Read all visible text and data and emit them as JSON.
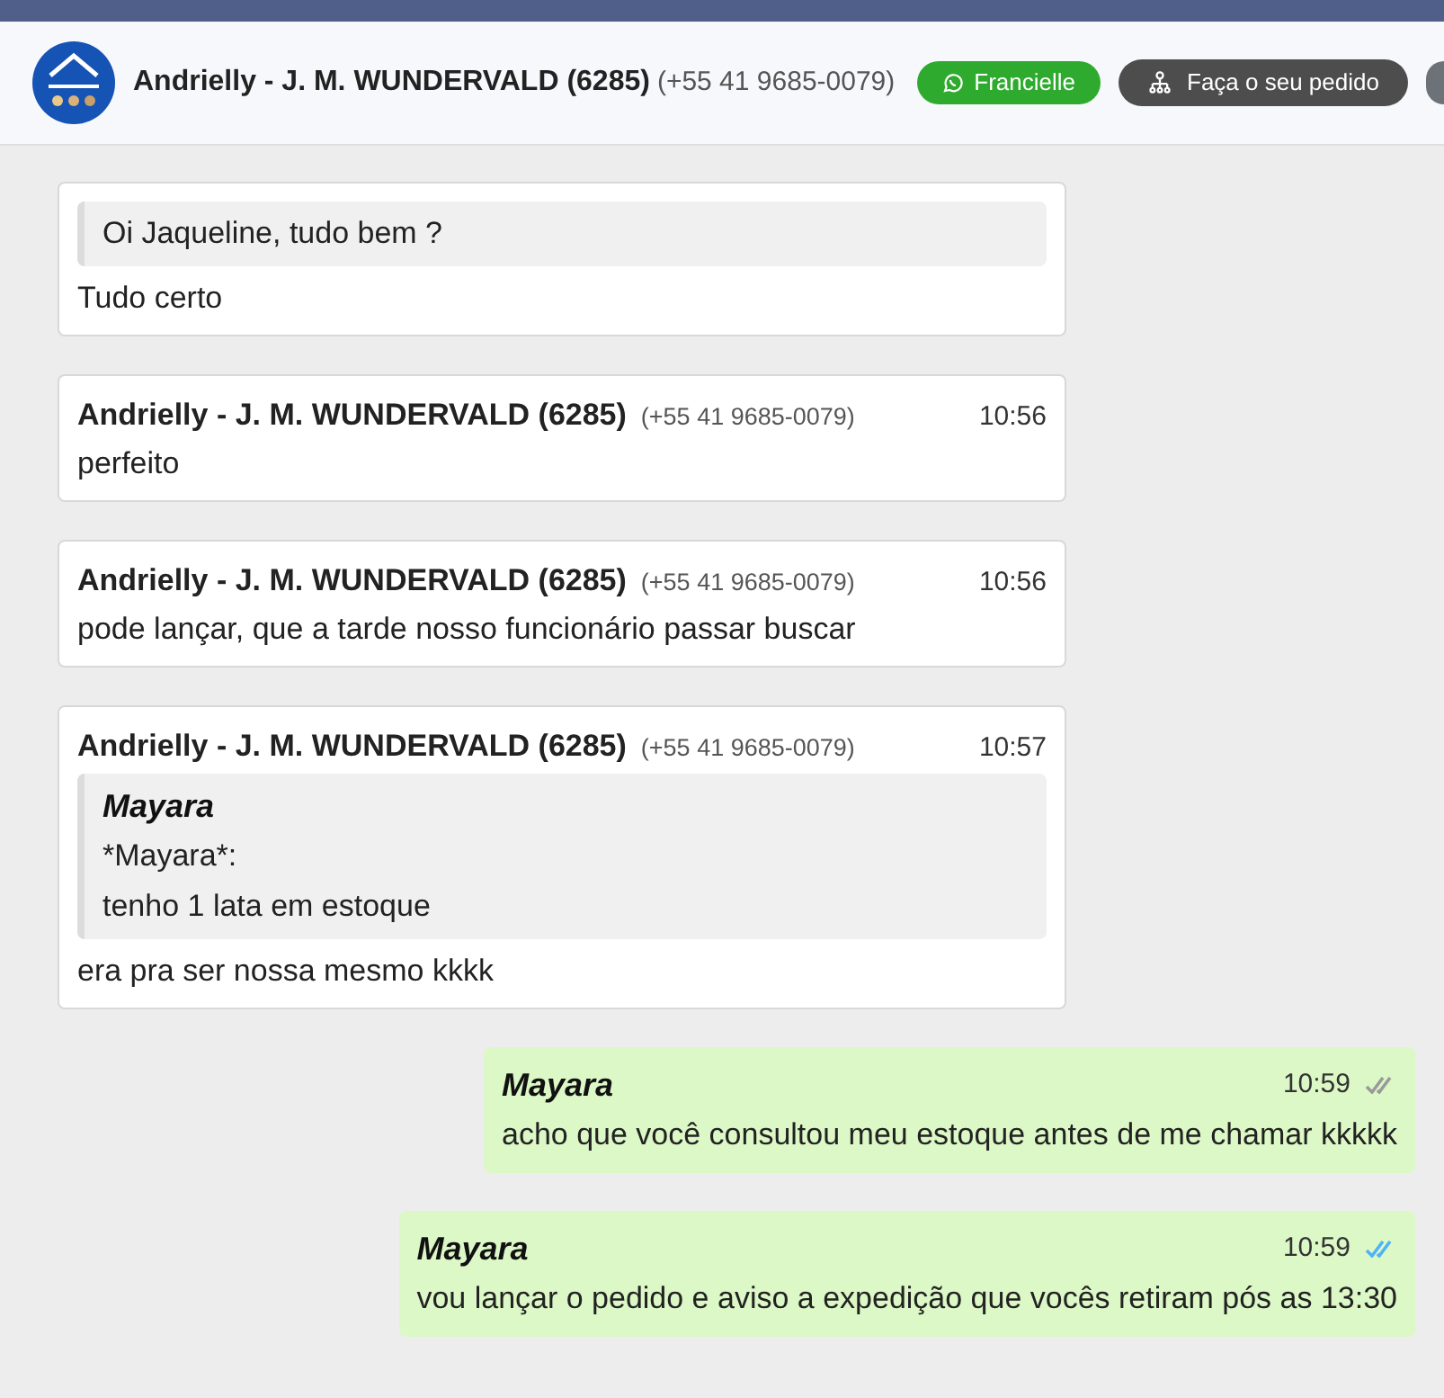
{
  "header": {
    "contact_name": "Andrielly - J. M. WUNDERVALD (6285)",
    "contact_phone": "(+55 41 9685-0079)",
    "buttons": [
      {
        "kind": "whatsapp",
        "label": "Francielle"
      },
      {
        "kind": "order",
        "label": "Faça o seu pedido"
      },
      {
        "kind": "cut"
      }
    ]
  },
  "messages": [
    {
      "kind": "in",
      "quote": {
        "lines": [
          "Oi Jaqueline, tudo bem ?"
        ]
      },
      "text": "Tudo certo"
    },
    {
      "kind": "in",
      "sender": "Andrielly - J. M. WUNDERVALD (6285)",
      "phone": "(+55 41 9685-0079)",
      "time": "10:56",
      "text": "perfeito"
    },
    {
      "kind": "in",
      "sender": "Andrielly - J. M. WUNDERVALD (6285)",
      "phone": "(+55 41 9685-0079)",
      "time": "10:56",
      "text": "pode lançar, que a tarde nosso funcionário passar buscar"
    },
    {
      "kind": "in",
      "sender": "Andrielly - J. M. WUNDERVALD (6285)",
      "phone": "(+55 41 9685-0079)",
      "time": "10:57",
      "quote": {
        "author": "Mayara",
        "lines": [
          "*Mayara*:",
          "tenho 1 lata em estoque"
        ]
      },
      "text": "era pra ser nossa mesmo kkkk"
    },
    {
      "kind": "out",
      "sender": "Mayara",
      "time": "10:59",
      "read": false,
      "text": "acho que você consultou meu estoque antes de me chamar kkkkk"
    },
    {
      "kind": "out",
      "sender": "Mayara",
      "time": "10:59",
      "read": true,
      "text": "vou lançar o pedido e aviso a expedição que vocês retiram pós as 13:30"
    }
  ]
}
